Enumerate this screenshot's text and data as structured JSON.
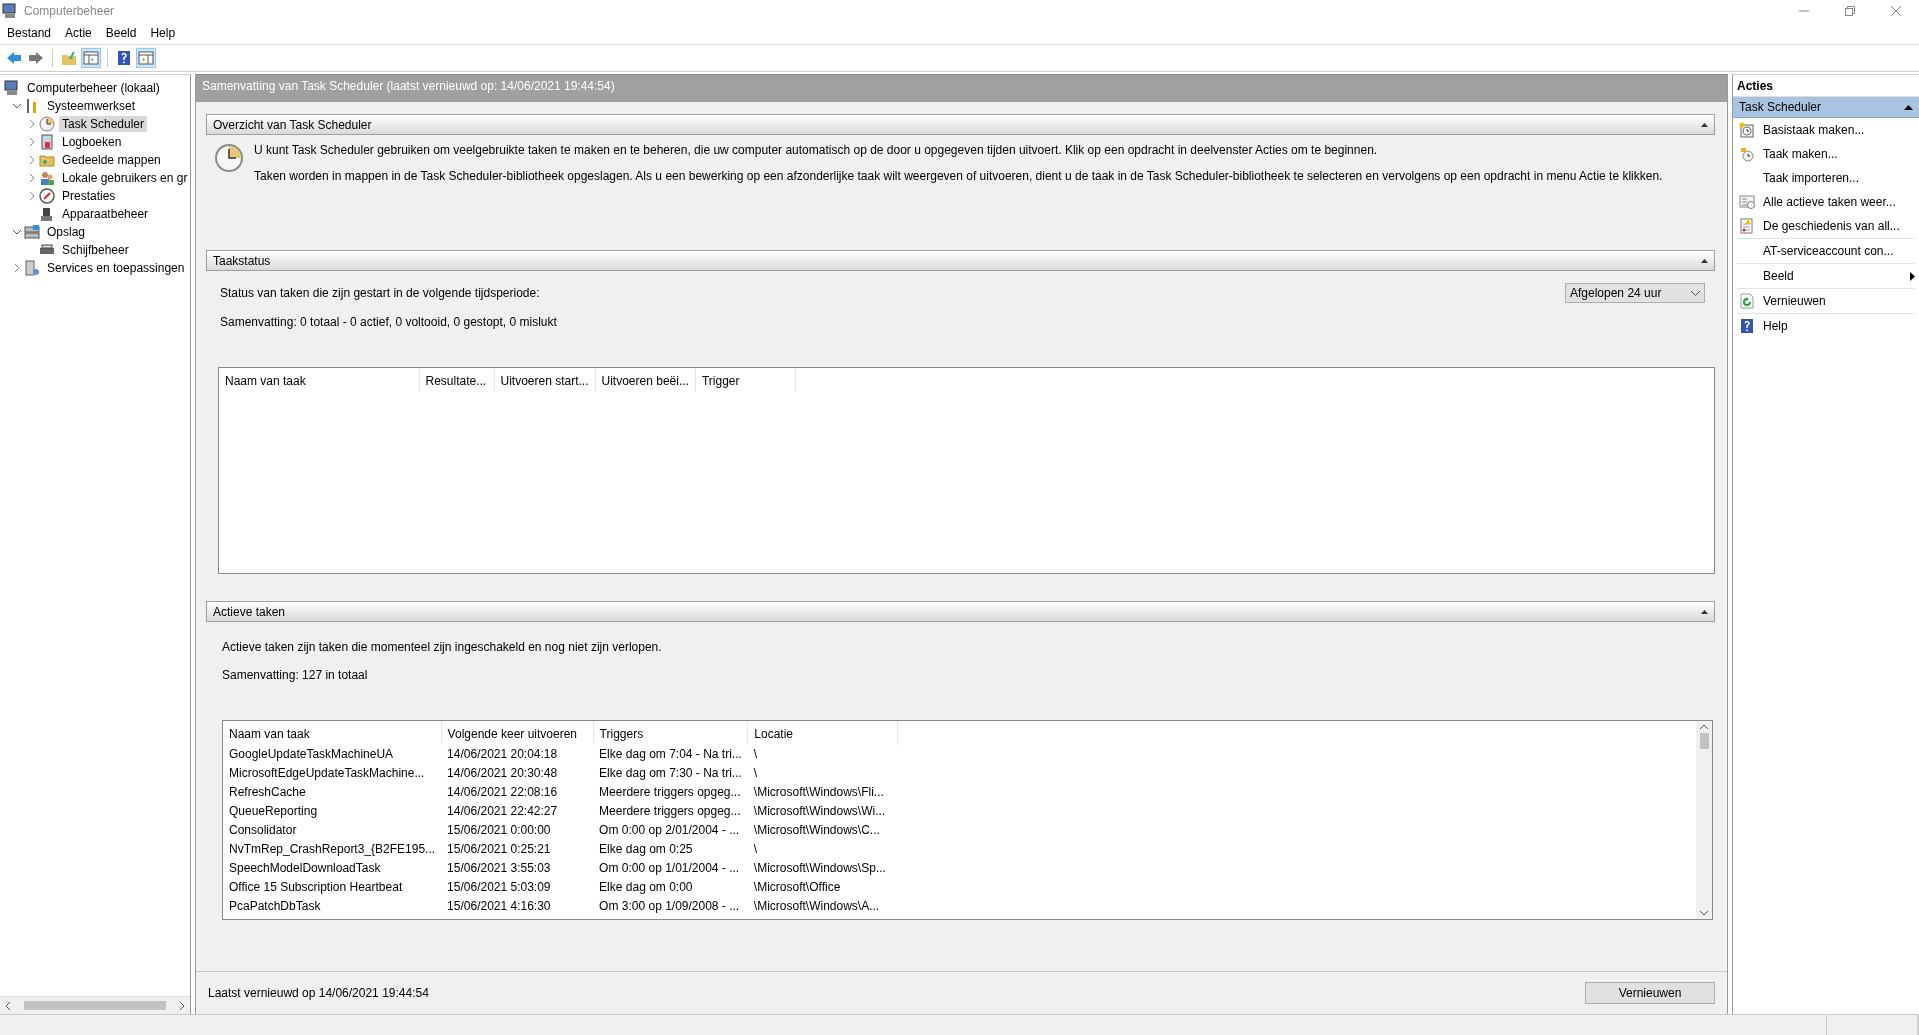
{
  "window": {
    "title": "Computerbeheer"
  },
  "menu": [
    {
      "label": "Bestand"
    },
    {
      "label": "Actie"
    },
    {
      "label": "Beeld"
    },
    {
      "label": "Help"
    }
  ],
  "toolbar": [
    {
      "kind": "back",
      "pressed": false
    },
    {
      "kind": "forward",
      "pressed": false
    },
    {
      "kind": "up",
      "pressed": false
    },
    {
      "kind": "console-tree",
      "pressed": true
    },
    {
      "kind": "help",
      "pressed": false
    },
    {
      "kind": "action-pane",
      "pressed": true
    }
  ],
  "tree": [
    {
      "label": "Computerbeheer (lokaal)",
      "kind": "computer",
      "selected": false,
      "children": [
        {
          "label": "Systeemwerkset",
          "kind": "tools",
          "selected": false,
          "expanded": true,
          "children": [
            {
              "label": "Task Scheduler",
              "kind": "clock",
              "selected": true,
              "expanded": false
            },
            {
              "label": "Logboeken",
              "kind": "log",
              "selected": false,
              "expanded": false
            },
            {
              "label": "Gedeelde mappen",
              "kind": "folder",
              "selected": false,
              "expanded": false
            },
            {
              "label": "Lokale gebruikers en gr",
              "kind": "users",
              "selected": false,
              "expanded": false
            },
            {
              "label": "Prestaties",
              "kind": "gauge",
              "selected": false,
              "expanded": false
            },
            {
              "label": "Apparaatbeheer",
              "kind": "device",
              "selected": false
            }
          ]
        },
        {
          "label": "Opslag",
          "kind": "storage",
          "selected": false,
          "expanded": true,
          "children": [
            {
              "label": "Schijfbeheer",
              "kind": "disk",
              "selected": false
            }
          ]
        },
        {
          "label": "Services en toepassingen",
          "kind": "services",
          "selected": false,
          "expanded": false
        }
      ]
    }
  ],
  "summary": {
    "title": "Samenvatting van Task Scheduler (laatst vernieuwd op: 14/06/2021 19:44:54)",
    "overview": {
      "title": "Overzicht van Task Scheduler",
      "expanded": true,
      "paragraphs": [
        "U kunt Task Scheduler gebruiken om veelgebruikte taken te maken en te beheren, die uw computer automatisch op de door u opgegeven tijden uitvoert. Klik op een opdracht in deelvenster Acties om te beginnen.",
        "Taken worden in mappen in de Task Scheduler-bibliotheek opgeslagen. Als u een bewerking op een afzonderlijke taak wilt weergeven of uitvoeren, dient u de taak in de Task Scheduler-bibliotheek te selecteren en vervolgens op een opdracht in menu Actie te klikken."
      ]
    },
    "status": {
      "title": "Taakstatus",
      "expanded": true,
      "prompt": "Status van taken die zijn gestart in de volgende tijdsperiode:",
      "period": "Afgelopen 24 uur",
      "summary": "Samenvatting: 0 totaal - 0 actief, 0 voltooid, 0 gestopt, 0 mislukt",
      "columns": [
        "Naam van taak",
        "Resultate...",
        "Uitvoeren start...",
        "Uitvoeren beëi...",
        "Trigger"
      ]
    },
    "active": {
      "title": "Actieve taken",
      "expanded": true,
      "description": "Actieve taken zijn taken die momenteel zijn ingeschakeld en nog niet zijn verlopen.",
      "summary": "Samenvatting: 127 in totaal",
      "columns": [
        "Naam van taak",
        "Volgende keer uitvoeren",
        "Triggers",
        "Locatie"
      ],
      "rows": [
        [
          "GoogleUpdateTaskMachineUA",
          "14/06/2021 20:04:18",
          "Elke dag om 7:04 - Na tri...",
          "\\"
        ],
        [
          "MicrosoftEdgeUpdateTaskMachine...",
          "14/06/2021 20:30:48",
          "Elke dag om 7:30 - Na tri...",
          "\\"
        ],
        [
          "RefreshCache",
          "14/06/2021 22:08:16",
          "Meerdere triggers opgeg...",
          "\\Microsoft\\Windows\\Fli..."
        ],
        [
          "QueueReporting",
          "14/06/2021 22:42:27",
          "Meerdere triggers opgeg...",
          "\\Microsoft\\Windows\\Wi..."
        ],
        [
          "Consolidator",
          "15/06/2021 0:00:00",
          "Om 0:00 op 2/01/2004 - ...",
          "\\Microsoft\\Windows\\C..."
        ],
        [
          "NvTmRep_CrashReport3_{B2FE195...",
          "15/06/2021 0:25:21",
          "Elke dag om 0:25",
          "\\"
        ],
        [
          "SpeechModelDownloadTask",
          "15/06/2021 3:55:03",
          "Om 0:00 op 1/01/2004 - ...",
          "\\Microsoft\\Windows\\Sp..."
        ],
        [
          "Office 15 Subscription Heartbeat",
          "15/06/2021 5:03:09",
          "Elke dag om 0:00",
          "\\Microsoft\\Office"
        ],
        [
          "PcaPatchDbTask",
          "15/06/2021 4:16:30",
          "Om 3:00 op 1/09/2008 - ...",
          "\\Microsoft\\Windows\\A..."
        ]
      ]
    },
    "footer": {
      "text": "Laatst vernieuwd op 14/06/2021 19:44:54",
      "button": "Vernieuwen"
    }
  },
  "actions": {
    "title": "Acties",
    "group": {
      "title": "Task Scheduler",
      "expanded": true
    },
    "groups": [
      [
        {
          "label": "Basistaak maken...",
          "kind": "basic-task",
          "submenu": false
        },
        {
          "label": "Taak maken...",
          "kind": "task",
          "submenu": false
        },
        {
          "label": "Taak importeren...",
          "kind": "none",
          "submenu": false
        },
        {
          "label": "Alle actieve taken weer...",
          "kind": "task-list",
          "submenu": false
        },
        {
          "label": "De geschiedenis van all...",
          "kind": "history",
          "submenu": false
        }
      ],
      [
        {
          "label": "AT-serviceaccount con...",
          "kind": "none",
          "submenu": false
        }
      ],
      [
        {
          "label": "Beeld",
          "kind": "none",
          "submenu": true
        }
      ],
      [
        {
          "label": "Vernieuwen",
          "kind": "refresh",
          "submenu": false
        }
      ],
      [
        {
          "label": "Help",
          "kind": "help",
          "submenu": false
        }
      ]
    ]
  }
}
